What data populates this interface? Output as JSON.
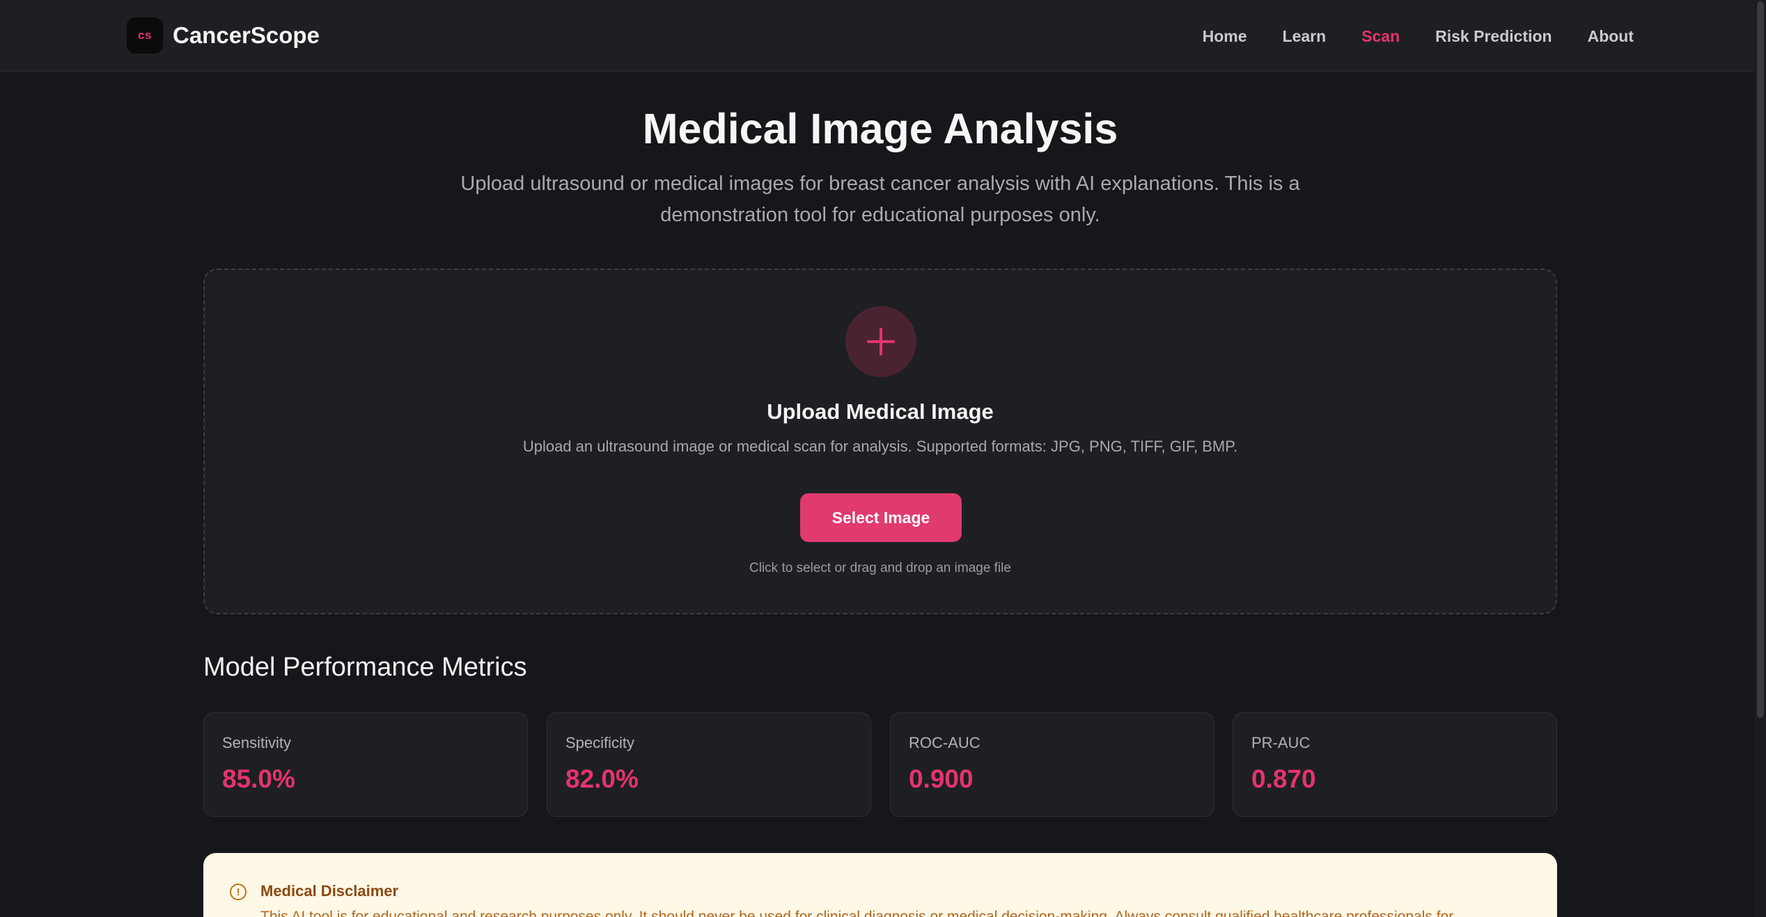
{
  "header": {
    "logo_text": "cs",
    "brand": "CancerScope",
    "nav": [
      {
        "label": "Home"
      },
      {
        "label": "Learn"
      },
      {
        "label": "Scan",
        "active": true
      },
      {
        "label": "Risk Prediction"
      },
      {
        "label": "About"
      }
    ]
  },
  "hero": {
    "title": "Medical Image Analysis",
    "subtitle": "Upload ultrasound or medical images for breast cancer analysis with AI explanations. This is a demonstration tool for educational purposes only."
  },
  "upload": {
    "icon": "plus-icon",
    "title": "Upload Medical Image",
    "description": "Upload an ultrasound image or medical scan for analysis. Supported formats: JPG, PNG, TIFF, GIF, BMP.",
    "button_label": "Select Image",
    "hint": "Click to select or drag and drop an image file"
  },
  "metrics": {
    "title": "Model Performance Metrics",
    "items": [
      {
        "label": "Sensitivity",
        "value": "85.0%"
      },
      {
        "label": "Specificity",
        "value": "82.0%"
      },
      {
        "label": "ROC-AUC",
        "value": "0.900"
      },
      {
        "label": "PR-AUC",
        "value": "0.870"
      }
    ]
  },
  "disclaimer": {
    "icon": "alert-circle-icon",
    "title": "Medical Disclaimer",
    "text": "This AI tool is for educational and research purposes only. It should never be used for clinical diagnosis or medical decision-making. Always consult qualified healthcare professionals for"
  },
  "colors": {
    "accent": "#e5336f",
    "background": "#16171b",
    "card": "#1e1f23",
    "disclaimer_bg": "#fef8e6"
  }
}
